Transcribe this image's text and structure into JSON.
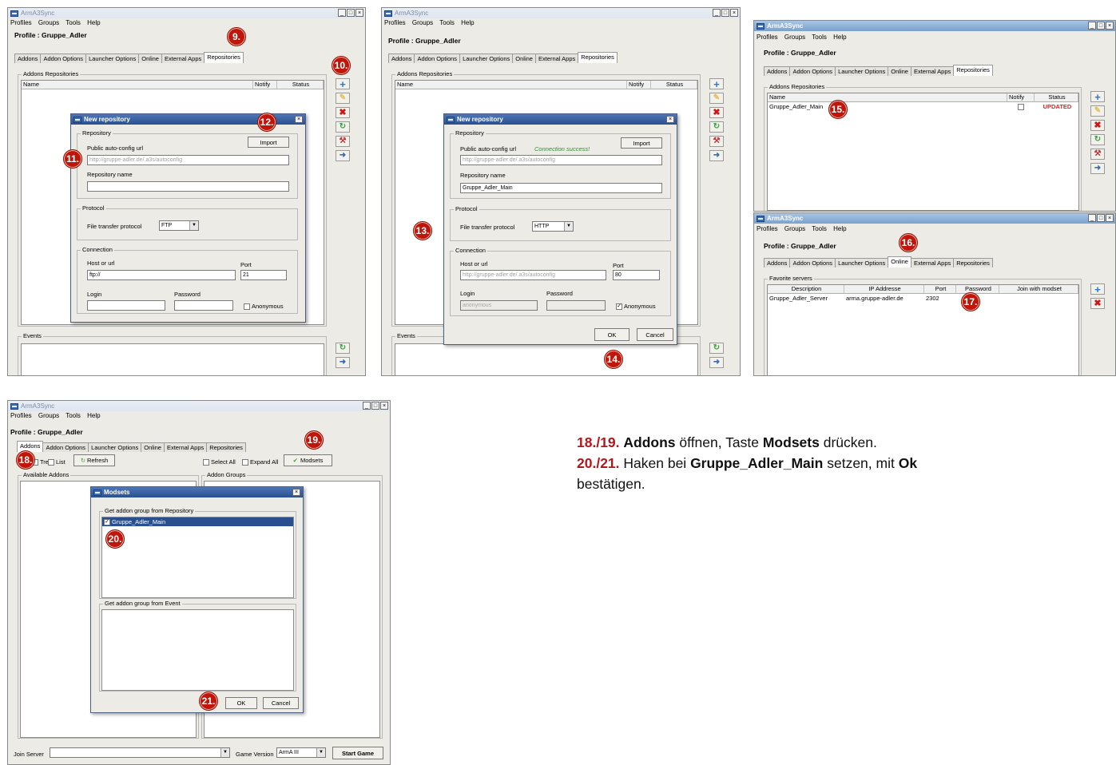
{
  "app": {
    "title": "ArmA3Sync",
    "menu": [
      "Profiles",
      "Groups",
      "Tools",
      "Help"
    ],
    "profile": "Profile : Gruppe_Adler",
    "tabs": [
      "Addons",
      "Addon Options",
      "Launcher Options",
      "Online",
      "External Apps",
      "Repositories"
    ],
    "winbtns": [
      "_",
      "□",
      "×"
    ]
  },
  "repos_panel": {
    "group_label": "Addons Repositories",
    "col_name": "Name",
    "col_notify": "Notify",
    "col_status": "Status",
    "events_label": "Events"
  },
  "dialog": {
    "title": "New repository",
    "repository_group": "Repository",
    "url_label": "Public auto-config url",
    "import_label": "Import",
    "url_value": "http://gruppe-adler.de/.a3s/autoconfig",
    "name_label": "Repository name",
    "protocol_group": "Protocol",
    "protocol_label": "File transfer protocol",
    "connection_group": "Connection",
    "host_label": "Host or url",
    "port_label": "Port",
    "login_label": "Login",
    "password_label": "Password",
    "anonymous_label": "Anonymous",
    "ok_label": "OK",
    "cancel_label": "Cancel",
    "close": "×"
  },
  "dialog_a": {
    "name_value": "",
    "protocol": "FTP",
    "host": "ftp://",
    "port": "21",
    "login": "",
    "password": ""
  },
  "dialog_b": {
    "success": "Connection success!",
    "name_value": "Gruppe_Adler_Main",
    "protocol": "HTTP",
    "host": "http://gruppe-adler.de/.a3s/autoconfig",
    "port": "80",
    "login": "anonymous",
    "anonymous_checked": "✓"
  },
  "win_c": {
    "repo_name": "Gruppe_Adler_Main",
    "repo_status": "UPDATED"
  },
  "win_d": {
    "group_label": "Favorite servers",
    "cols": [
      "Description",
      "IP Addresse",
      "Port",
      "Password",
      "Join with modset"
    ],
    "row": [
      "Gruppe_Adler_Server",
      "arma.gruppe-adler.de",
      "2302",
      "",
      ""
    ]
  },
  "win_e": {
    "tree_label": "Tree",
    "list_label": "List",
    "refresh_label": "Refresh",
    "select_all": "Select All",
    "expand_all": "Expand All",
    "modsets_label": "Modsets",
    "available_addons": "Available Addons",
    "addon_groups": "Addon Groups",
    "modsets_title": "Modsets",
    "repo_group_label": "Get addon group from Repository",
    "repo_item": "Gruppe_Adler_Main",
    "event_group_label": "Get addon group from Event",
    "join_server": "Join Server",
    "game_version_label": "Game Version",
    "game_version": "ArmA III",
    "start_game": "Start Game"
  },
  "badges": [
    "9.",
    "10.",
    "11.",
    "12.",
    "13.",
    "14.",
    "15.",
    "16.",
    "17.",
    "18.",
    "19.",
    "20.",
    "21."
  ],
  "instructions": {
    "line1_num": "18./19.",
    "line1_b1": "Addons",
    "line1_t1": " öffnen, Taste ",
    "line1_b2": "Modsets",
    "line1_t2": " drücken.",
    "line2_num": "20./21.",
    "line2_t1": " Haken bei ",
    "line2_b1": "Gruppe_Adler_Main",
    "line2_t2": " setzen, mit ",
    "line2_b2": "Ok",
    "line2_t3": "bestätigen."
  },
  "colors": {
    "badge": "#c0150a",
    "updated": "#e02020",
    "instruction_num": "#b0191c"
  }
}
